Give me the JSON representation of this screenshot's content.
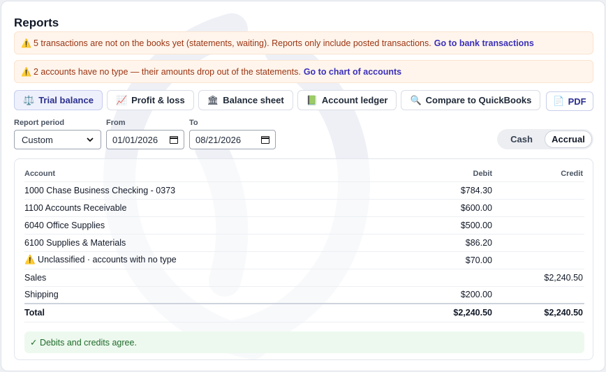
{
  "page": {
    "title": "Reports"
  },
  "alerts": [
    {
      "icon": "⚠️",
      "text": "5 transactions are not on the books yet (statements, waiting). Reports only include posted transactions.",
      "link": "Go to bank transactions"
    },
    {
      "icon": "⚠️",
      "text": "2 accounts have no type — their amounts drop out of the statements.",
      "link": "Go to chart of accounts"
    }
  ],
  "tabs": [
    {
      "icon": "⚖️",
      "label": "Trial balance",
      "active": true
    },
    {
      "icon": "📈",
      "label": "Profit & loss"
    },
    {
      "icon": "🏛",
      "label": "Balance sheet"
    },
    {
      "icon": "📗",
      "label": "Account ledger"
    },
    {
      "icon": "🔍",
      "label": "Compare to QuickBooks"
    }
  ],
  "pdf": {
    "icon": "📄",
    "label": "PDF"
  },
  "filters": {
    "period_label": "Report period",
    "period_value": "Custom",
    "from_label": "From",
    "from_value": "01/01/2026",
    "to_label": "To",
    "to_value": "08/21/2026"
  },
  "basis": {
    "options": [
      "Cash",
      "Accrual"
    ],
    "selected": "Accrual"
  },
  "table": {
    "headers": {
      "account": "Account",
      "debit": "Debit",
      "credit": "Credit"
    },
    "rows": [
      {
        "account": "1000 Chase Business Checking - 0373",
        "debit": "$784.30",
        "credit": ""
      },
      {
        "account": "1100 Accounts Receivable",
        "debit": "$600.00",
        "credit": ""
      },
      {
        "account": "6040 Office Supplies",
        "debit": "$500.00",
        "credit": ""
      },
      {
        "account": "6100 Supplies & Materials",
        "debit": "$86.20",
        "credit": ""
      },
      {
        "account": "⚠️ Unclassified · accounts with no type",
        "debit": "$70.00",
        "credit": ""
      },
      {
        "account": "Sales",
        "debit": "",
        "credit": "$2,240.50"
      },
      {
        "account": "Shipping",
        "debit": "$200.00",
        "credit": ""
      }
    ],
    "total": {
      "label": "Total",
      "debit": "$2,240.50",
      "credit": "$2,240.50"
    }
  },
  "status": {
    "text": "✓ Debits and credits agree."
  }
}
